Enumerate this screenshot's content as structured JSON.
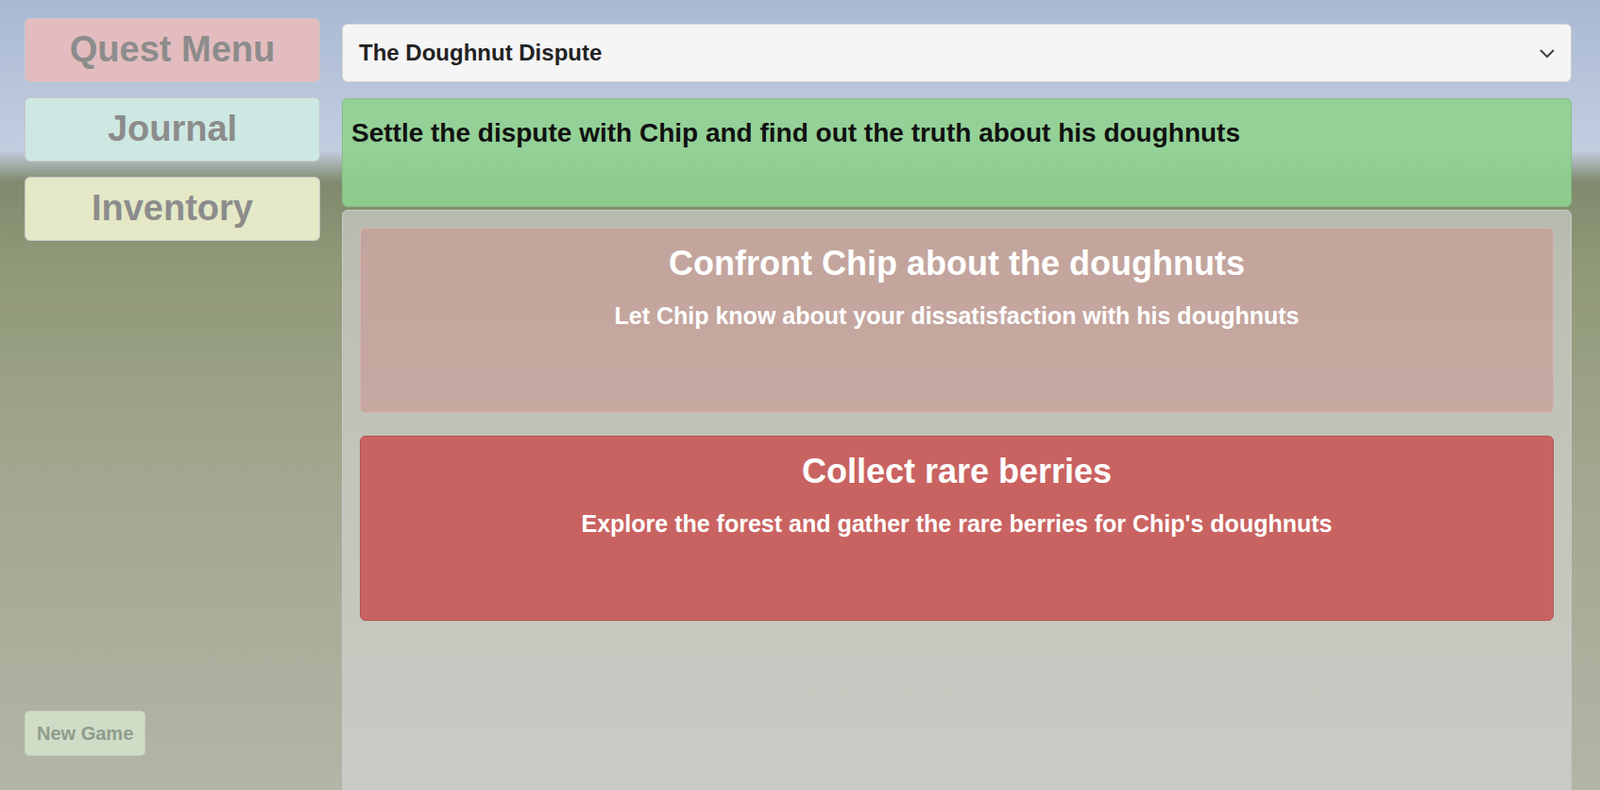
{
  "menu": [
    {
      "label": "Quest Menu",
      "color": "#e2bcbe"
    },
    {
      "label": "Journal",
      "color": "#cde8e3"
    },
    {
      "label": "Inventory",
      "color": "#e4e8c6"
    }
  ],
  "new_game": "New Game",
  "quest_select": {
    "value": "The Doughnut Dispute"
  },
  "quest_description": "Settle the dispute with Chip and find out the truth about his doughnuts",
  "objectives": [
    {
      "title": "Confront Chip about the doughnuts",
      "description": "Let Chip know about your dissatisfaction with his doughnuts",
      "active": false
    },
    {
      "title": "Collect rare berries",
      "description": "Explore the forest and gather the rare berries for Chip's doughnuts",
      "active": true
    }
  ]
}
